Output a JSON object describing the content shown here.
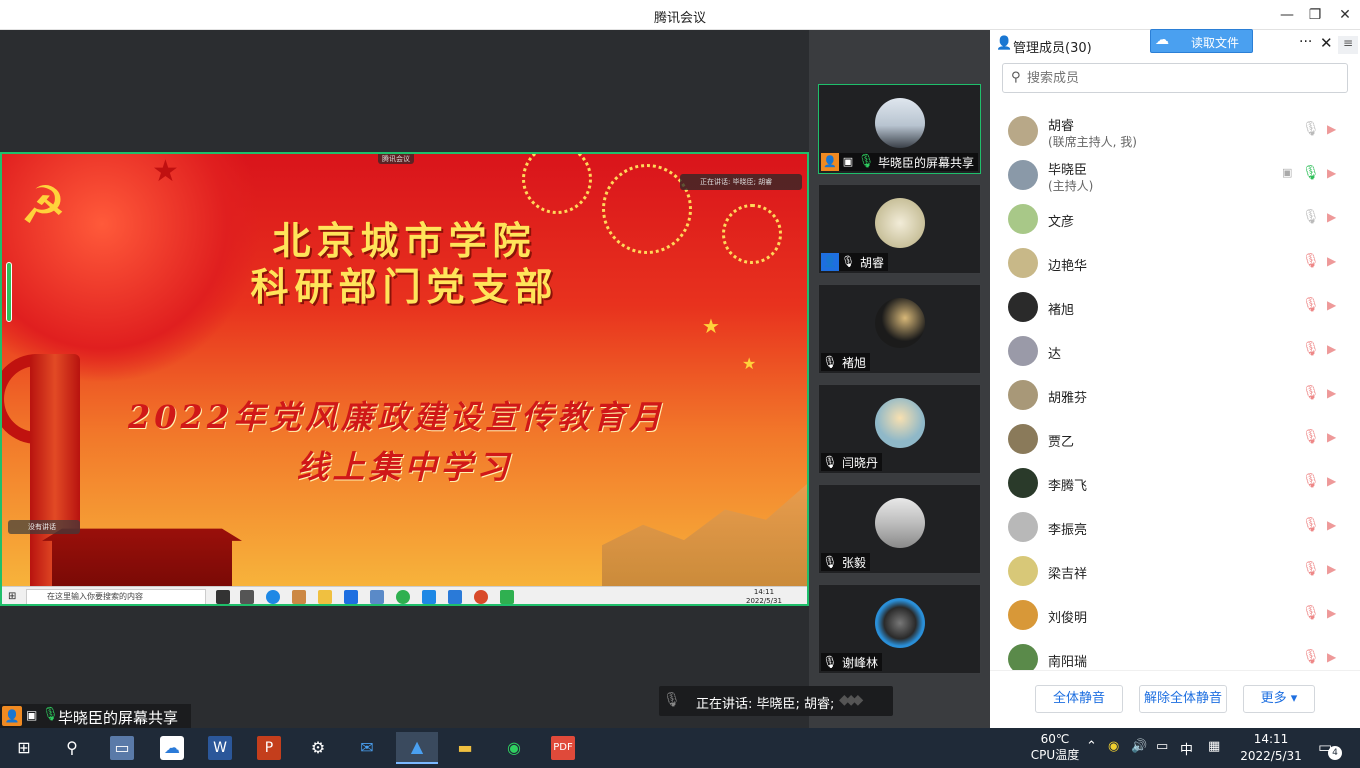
{
  "window": {
    "title": "腾讯会议",
    "minimize": "—",
    "maximize": "❐",
    "close": "✕"
  },
  "slide": {
    "line1": "北京城市学院",
    "line2": "科研部门党支部",
    "line3": "2022年党风廉政建设宣传教育月",
    "line4": "线上集中学习",
    "mini_bar": "腾讯会议",
    "mini_speaking": "正在讲话: 毕晓臣; 胡睿",
    "mini_left": "没有讲话"
  },
  "inner_taskbar": {
    "search_placeholder": "在这里输入你要搜索的内容",
    "time": "14:11",
    "date": "2022/5/31"
  },
  "share_label": "毕晓臣的屏幕共享",
  "gallery": [
    {
      "name": "毕晓臣的屏幕共享",
      "state": "sharing",
      "avatar_color": "#c9d3de"
    },
    {
      "name": "胡睿",
      "state": "me",
      "avatar_color": "#d8d2b4"
    },
    {
      "name": "褚旭",
      "state": "muted",
      "avatar_color": "#1b1b1b"
    },
    {
      "name": "闫晓丹",
      "state": "muted",
      "avatar_color": "#8fb8c8"
    },
    {
      "name": "张毅",
      "state": "muted",
      "avatar_color": "#cfcfcf"
    },
    {
      "name": "谢峰林",
      "state": "muted",
      "avatar_color": "#2a8fd8"
    }
  ],
  "speaking": {
    "text": "正在讲话: 毕晓臣; 胡睿;"
  },
  "panel": {
    "title": "管理成员(30)",
    "read_file": "读取文件",
    "search_placeholder": "搜索成员",
    "members": [
      {
        "name": "胡睿",
        "role": "(联席主持人, 我)",
        "mic": "off",
        "avatar_color": "#b8a888"
      },
      {
        "name": "毕晓臣",
        "role": "(主持人)",
        "mic": "on",
        "screen": true,
        "avatar_color": "#8a99a8"
      },
      {
        "name": "文彦",
        "role": "",
        "mic": "off",
        "avatar_color": "#a8c888"
      },
      {
        "name": "边艳华",
        "role": "",
        "mic": "muted",
        "avatar_color": "#c8b888"
      },
      {
        "name": "褚旭",
        "role": "",
        "mic": "muted",
        "avatar_color": "#2a2a2a"
      },
      {
        "name": "达",
        "role": "",
        "mic": "muted",
        "avatar_color": "#9a9aa8"
      },
      {
        "name": "胡雅芬",
        "role": "",
        "mic": "muted",
        "avatar_color": "#a89878"
      },
      {
        "name": "贾乙",
        "role": "",
        "mic": "muted",
        "avatar_color": "#8a7a5a"
      },
      {
        "name": "李腾飞",
        "role": "",
        "mic": "muted",
        "avatar_color": "#2a3a2a"
      },
      {
        "name": "李振亮",
        "role": "",
        "mic": "muted",
        "avatar_color": "#b8b8b8"
      },
      {
        "name": "梁吉祥",
        "role": "",
        "mic": "muted",
        "avatar_color": "#d8c878"
      },
      {
        "name": "刘俊明",
        "role": "",
        "mic": "muted",
        "avatar_color": "#d89838"
      },
      {
        "name": "南阳瑞",
        "role": "",
        "mic": "muted",
        "avatar_color": "#5a8a4a"
      }
    ],
    "footer": {
      "mute_all": "全体静音",
      "unmute_all": "解除全体静音",
      "more": "更多 ▾"
    }
  },
  "taskbar": {
    "temp": "60℃",
    "temp_label": "CPU温度",
    "ime": "中",
    "time": "14:11",
    "date": "2022/5/31",
    "notifications": "4"
  }
}
